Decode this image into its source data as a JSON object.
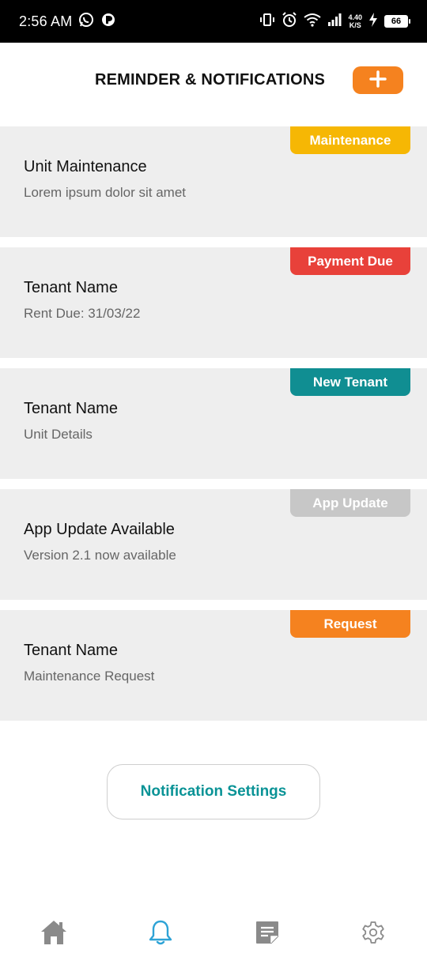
{
  "status_bar": {
    "time": "2:56 AM",
    "speed_value": "4.40",
    "speed_unit": "K/S",
    "battery": "66"
  },
  "header": {
    "title": "REMINDER & NOTIFICATIONS",
    "add_icon": "plus-icon"
  },
  "colors": {
    "accent_orange": "#f5821f",
    "maintenance": "#f6b704",
    "payment_due": "#e8413a",
    "new_tenant": "#108e92",
    "app_update": "#c7c7c7",
    "request": "#f5821f",
    "teal_text": "#0a9396",
    "active_nav": "#2ea3d6",
    "inactive_nav": "#8a8a8a"
  },
  "notifications": [
    {
      "badge": "Maintenance",
      "title": "Unit Maintenance",
      "subtitle": "Lorem ipsum dolor sit amet"
    },
    {
      "badge": "Payment Due",
      "title": "Tenant Name",
      "subtitle": "Rent Due: 31/03/22"
    },
    {
      "badge": "New Tenant",
      "title": "Tenant Name",
      "subtitle": "Unit Details"
    },
    {
      "badge": "App Update",
      "title": "App Update Available",
      "subtitle": "Version 2.1 now available"
    },
    {
      "badge": "Request",
      "title": "Tenant Name",
      "subtitle": "Maintenance Request"
    }
  ],
  "settings_button": "Notification Settings",
  "bottom_nav": [
    {
      "icon": "home-icon",
      "active": false
    },
    {
      "icon": "bell-icon",
      "active": true
    },
    {
      "icon": "notes-icon",
      "active": false
    },
    {
      "icon": "gear-icon",
      "active": false
    }
  ]
}
